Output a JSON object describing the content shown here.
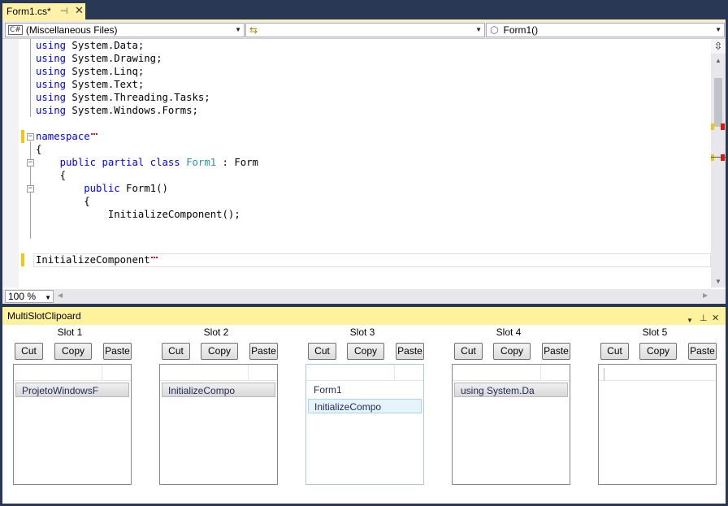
{
  "tab": {
    "title": "Form1.cs*",
    "pin_glyph": "⊣",
    "close_glyph": "✕"
  },
  "navbar": {
    "project_combo": "(Miscellaneous Files)",
    "type_combo": "",
    "member_combo": "Form1()",
    "project_icon": "C#"
  },
  "code": {
    "lines": [
      {
        "kw": "using",
        "rest": " System.Data;"
      },
      {
        "kw": "using",
        "rest": " System.Drawing;"
      },
      {
        "kw": "using",
        "rest": " System.Linq;"
      },
      {
        "kw": "using",
        "rest": " System.Text;"
      },
      {
        "kw": "using",
        "rest": " System.Threading.Tasks;"
      },
      {
        "kw": "using",
        "rest": " System.Windows.Forms;"
      }
    ],
    "namespace_kw": "namespace",
    "brace_open": "{",
    "class_line": {
      "kw": "public partial class",
      "type": "Form1",
      "rest": " : Form"
    },
    "brace_open2": "{",
    "ctor_line": {
      "kw": "public",
      "rest": " Form1()"
    },
    "brace_open3": "{",
    "init_call": "InitializeComponent();",
    "typed_line": "InitializeComponent"
  },
  "editor_status": {
    "zoom": "100 %"
  },
  "toolwindow": {
    "title": "MultiSlotClipoard",
    "slots": [
      {
        "title": "Slot 1",
        "cut": "Cut",
        "copy": "Copy",
        "paste": "Paste",
        "items": [
          "ProjetoWindowsF"
        ]
      },
      {
        "title": "Slot 2",
        "cut": "Cut",
        "copy": "Copy",
        "paste": "Paste",
        "items": [
          "InitializeCompo"
        ]
      },
      {
        "title": "Slot 3",
        "cut": "Cut",
        "copy": "Copy",
        "paste": "Paste",
        "items": [
          "Form1",
          "InitializeCompo"
        ]
      },
      {
        "title": "Slot 4",
        "cut": "Cut",
        "copy": "Copy",
        "paste": "Paste",
        "items": [
          "using System.Da"
        ]
      },
      {
        "title": "Slot 5",
        "cut": "Cut",
        "copy": "Copy",
        "paste": "Paste",
        "items": []
      }
    ]
  },
  "colors": {
    "chrome": "#293955",
    "active_tab": "#fff1a8",
    "keyword": "#0000ff",
    "type": "#2b91af",
    "change_marker": "#efc711",
    "error_squiggle": "#e51400"
  }
}
